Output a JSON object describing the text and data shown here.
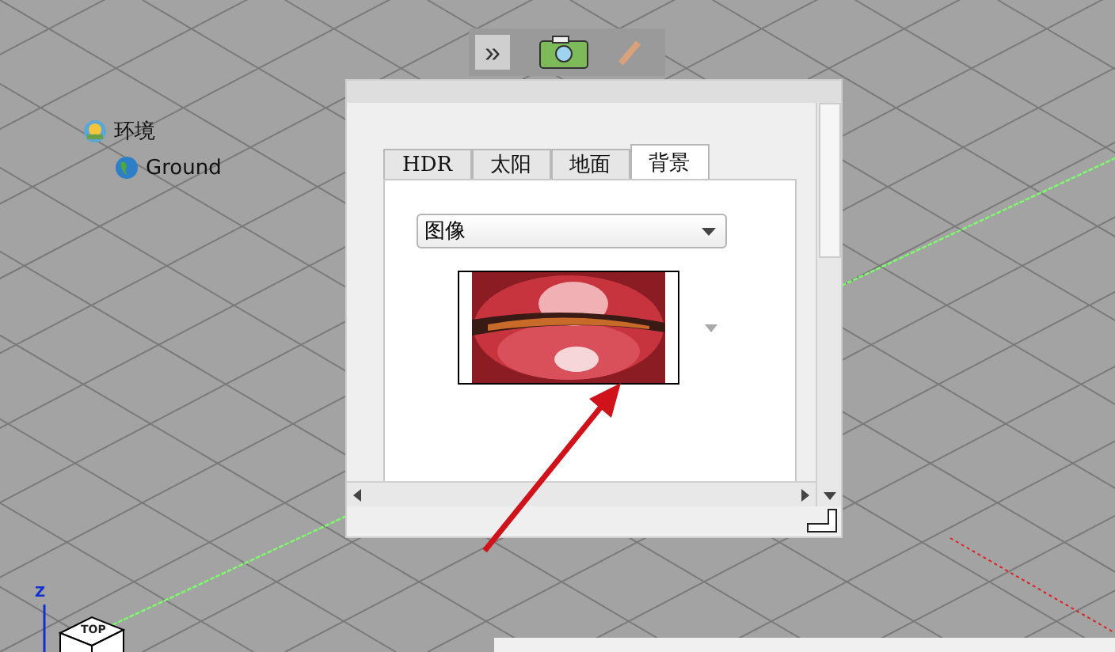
{
  "scene_tree": [
    {
      "label": "环境",
      "kind": "environment",
      "children": [
        {
          "label": "Ground",
          "kind": "globe"
        }
      ]
    }
  ],
  "toolbar": {
    "overflow": "»"
  },
  "panel": {
    "tabs": [
      {
        "label": "HDR",
        "selected": false
      },
      {
        "label": "太阳",
        "selected": false
      },
      {
        "label": "地面",
        "selected": false
      },
      {
        "label": "背景",
        "selected": true
      }
    ],
    "background_type": {
      "value": "图像"
    }
  },
  "view_cube": {
    "axis": "Z",
    "face": "TOP"
  }
}
